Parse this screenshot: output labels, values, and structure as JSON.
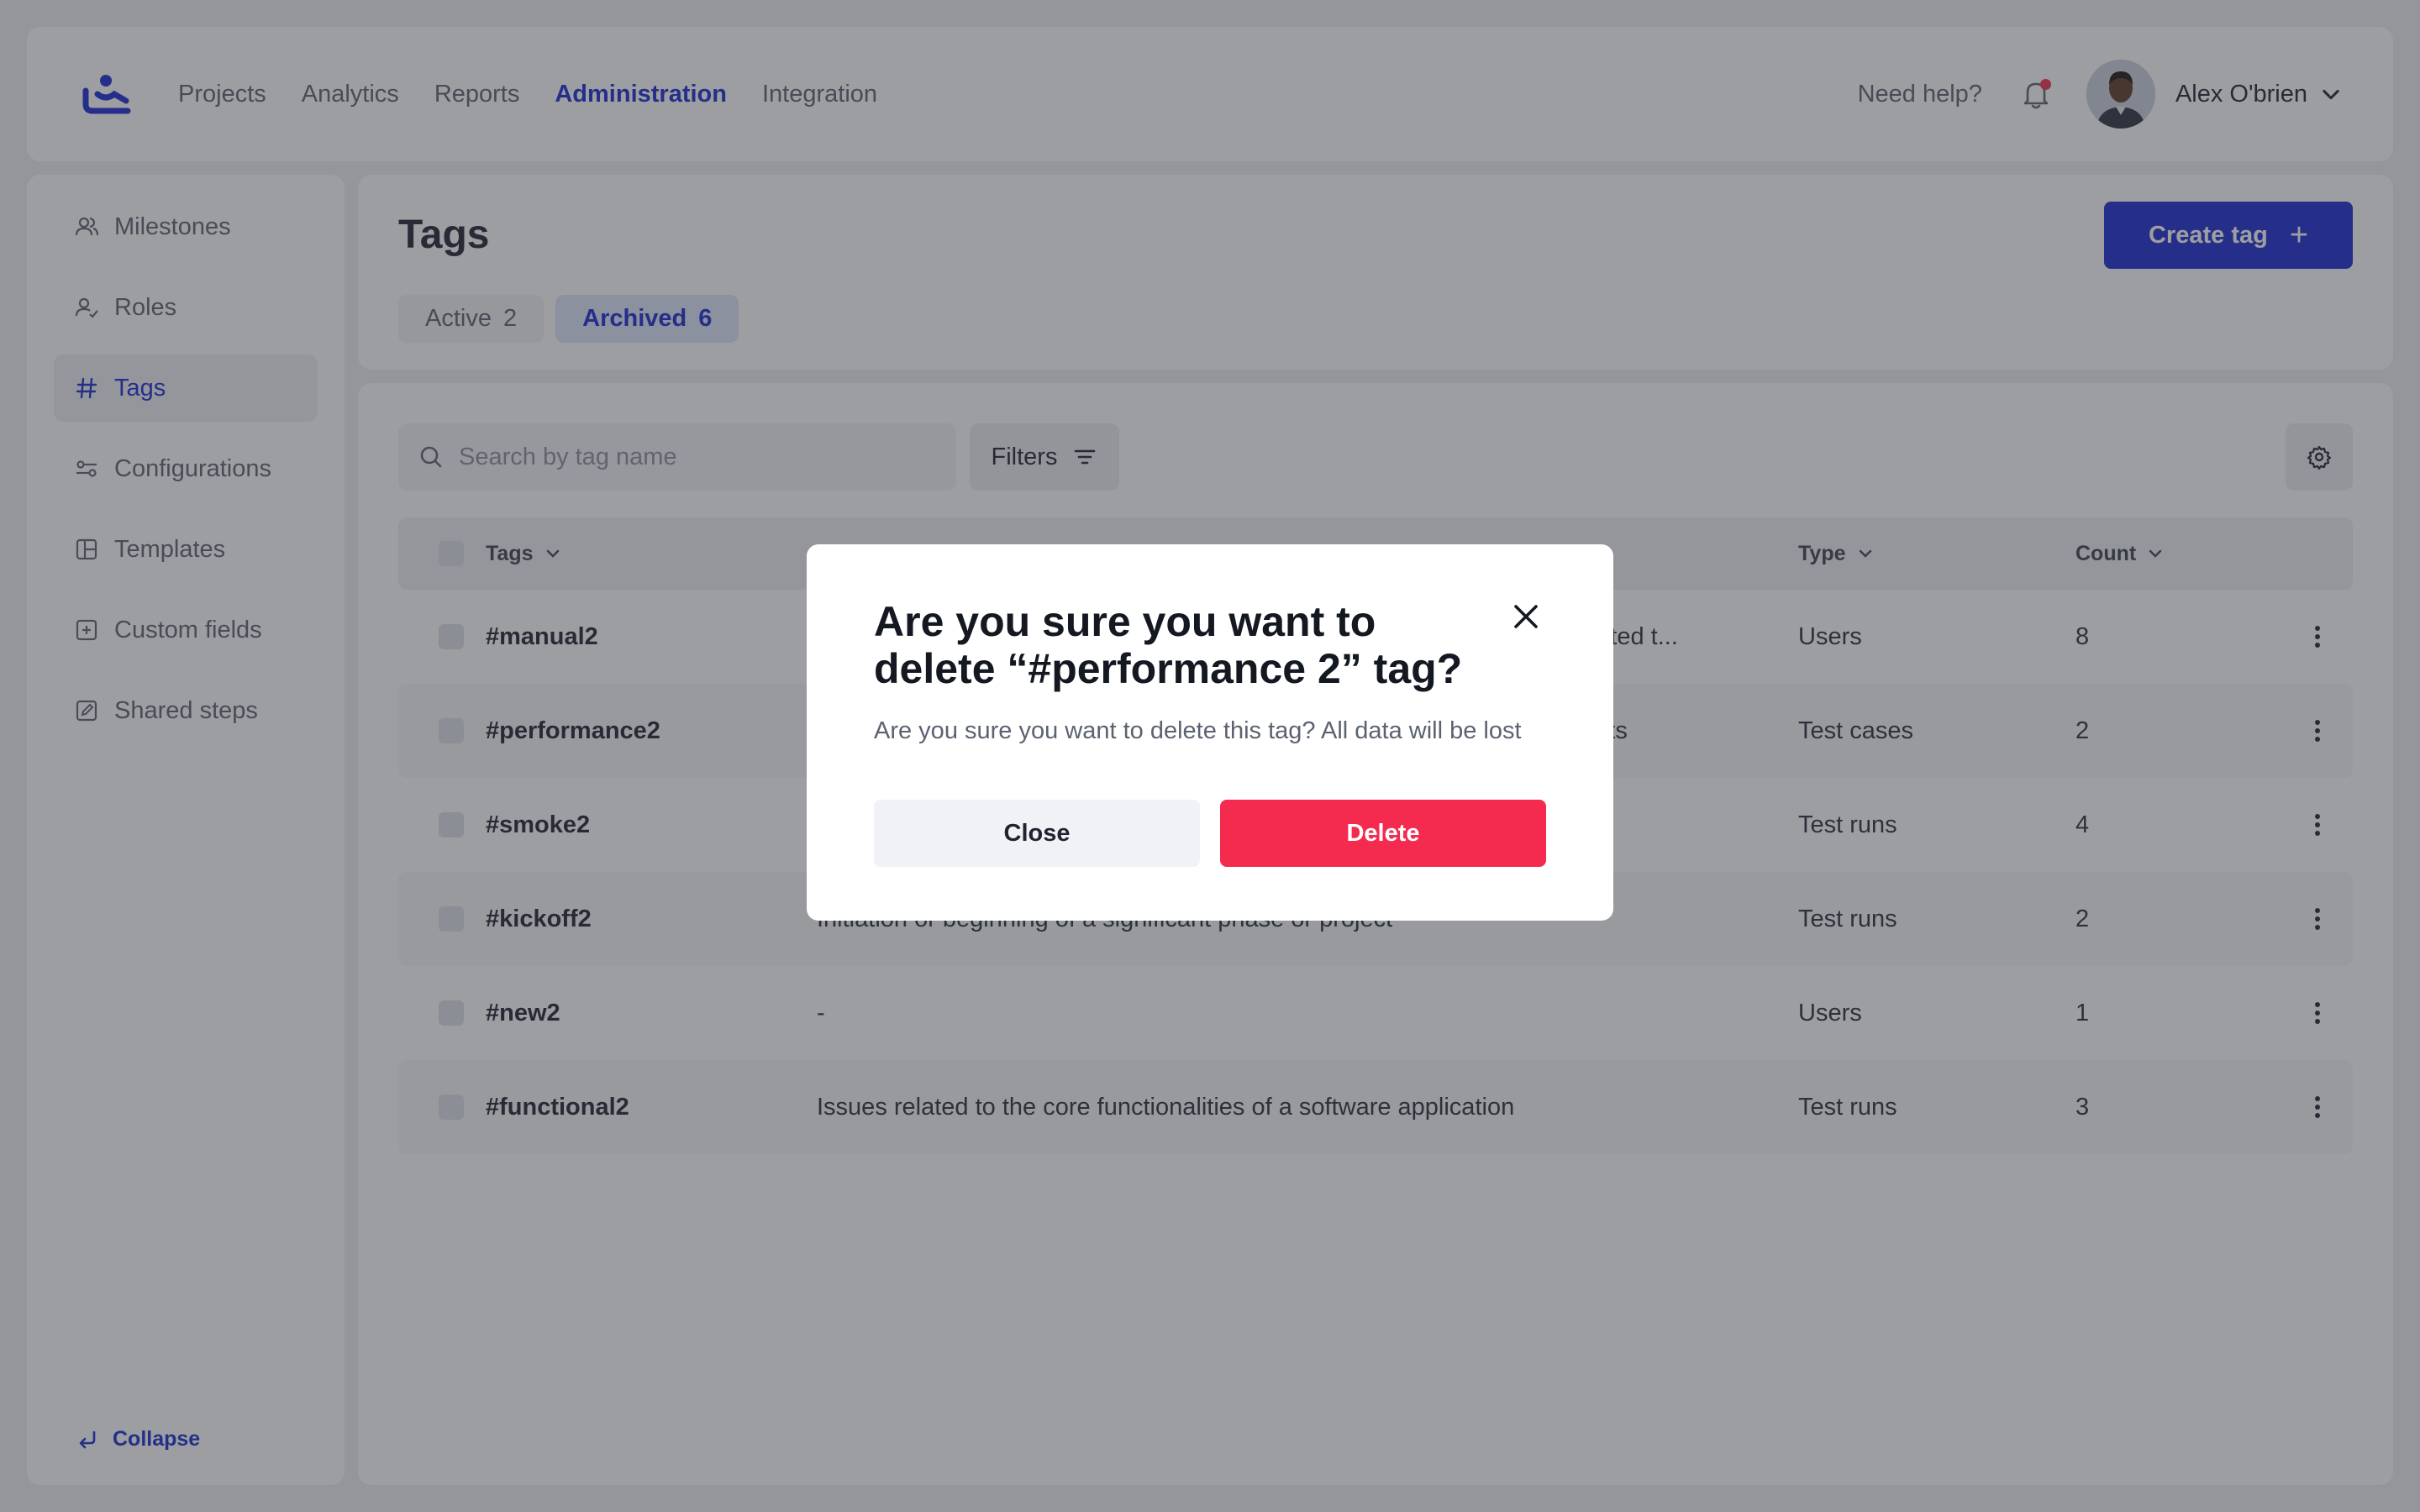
{
  "nav": {
    "items": [
      {
        "label": "Projects"
      },
      {
        "label": "Analytics"
      },
      {
        "label": "Reports"
      },
      {
        "label": "Administration",
        "active": true
      },
      {
        "label": "Integration"
      }
    ],
    "help": "Need help?",
    "user": "Alex O'brien"
  },
  "sidebar": {
    "items": [
      {
        "label": "Milestones",
        "icon": "users-icon"
      },
      {
        "label": "Roles",
        "icon": "user-check-icon"
      },
      {
        "label": "Tags",
        "icon": "hash-icon",
        "active": true
      },
      {
        "label": "Configurations",
        "icon": "sliders-icon"
      },
      {
        "label": "Templates",
        "icon": "layout-icon"
      },
      {
        "label": "Custom fields",
        "icon": "plus-square-icon"
      },
      {
        "label": "Shared steps",
        "icon": "edit-square-icon"
      }
    ],
    "collapse": "Collapse"
  },
  "header": {
    "title": "Tags",
    "create_label": "Create tag",
    "tabs": [
      {
        "label": "Active",
        "count": "2"
      },
      {
        "label": "Archived",
        "count": "6",
        "active": true
      }
    ]
  },
  "toolbar": {
    "search_placeholder": "Search by tag name",
    "filters_label": "Filters"
  },
  "table": {
    "columns": {
      "tags": "Tags",
      "type": "Type",
      "count": "Count"
    },
    "rows": [
      {
        "name": "#manual2",
        "desc": "",
        "desc_tail": "mated t...",
        "type": "Users",
        "count": "8"
      },
      {
        "name": "#performance2",
        "desc": "",
        "desc_tail": "ents",
        "type": "Test cases",
        "count": "2"
      },
      {
        "name": "#smoke2",
        "desc": "",
        "desc_tail": "",
        "type": "Test runs",
        "count": "4"
      },
      {
        "name": "#kickoff2",
        "desc": "Initiation or beginning of a significant phase or project",
        "desc_tail": "",
        "type": "Test runs",
        "count": "2"
      },
      {
        "name": "#new2",
        "desc": "-",
        "desc_tail": "",
        "type": "Users",
        "count": "1"
      },
      {
        "name": "#functional2",
        "desc": "Issues related to the core functionalities of a software application",
        "desc_tail": "",
        "type": "Test runs",
        "count": "3"
      }
    ]
  },
  "modal": {
    "title": "Are you sure you want to delete “#performance 2” tag?",
    "text": "Are you sure you want to delete this tag? All data will be lost",
    "close_label": "Close",
    "delete_label": "Delete"
  },
  "colors": {
    "accent": "#1a2bd1",
    "danger": "#f42a4f",
    "notification": "#ef2e50"
  }
}
